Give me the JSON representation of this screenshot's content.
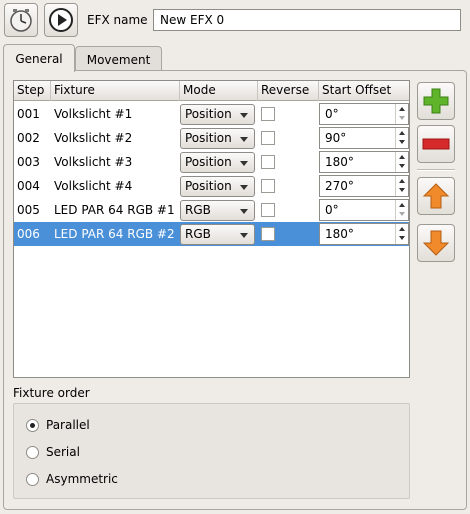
{
  "toolbar": {
    "name_label": "EFX name",
    "name_value": "New EFX 0"
  },
  "tabs": [
    {
      "label": "General",
      "active": true
    },
    {
      "label": "Movement",
      "active": false
    }
  ],
  "table": {
    "headers": [
      "Step",
      "Fixture",
      "Mode",
      "Reverse",
      "Start Offset"
    ],
    "rows": [
      {
        "step": "001",
        "fixture": "Volkslicht #1",
        "mode": "Position",
        "reverse": false,
        "offset": "0°"
      },
      {
        "step": "002",
        "fixture": "Volkslicht #2",
        "mode": "Position",
        "reverse": false,
        "offset": "90°"
      },
      {
        "step": "003",
        "fixture": "Volkslicht #3",
        "mode": "Position",
        "reverse": false,
        "offset": "180°"
      },
      {
        "step": "004",
        "fixture": "Volkslicht #4",
        "mode": "Position",
        "reverse": false,
        "offset": "270°"
      },
      {
        "step": "005",
        "fixture": "LED PAR 64 RGB #1",
        "mode": "RGB",
        "reverse": false,
        "offset": "0°"
      },
      {
        "step": "006",
        "fixture": "LED PAR 64 RGB #2",
        "mode": "RGB",
        "reverse": false,
        "offset": "180°",
        "selected": true
      }
    ]
  },
  "fixture_order": {
    "title": "Fixture order",
    "options": [
      {
        "label": "Parallel",
        "checked": true
      },
      {
        "label": "Serial",
        "checked": false
      },
      {
        "label": "Asymmetric",
        "checked": false
      }
    ]
  },
  "colors": {
    "selection": "#4a90d9",
    "add": "#5fb52a",
    "remove": "#d62a2a",
    "move": "#f08a2a"
  }
}
